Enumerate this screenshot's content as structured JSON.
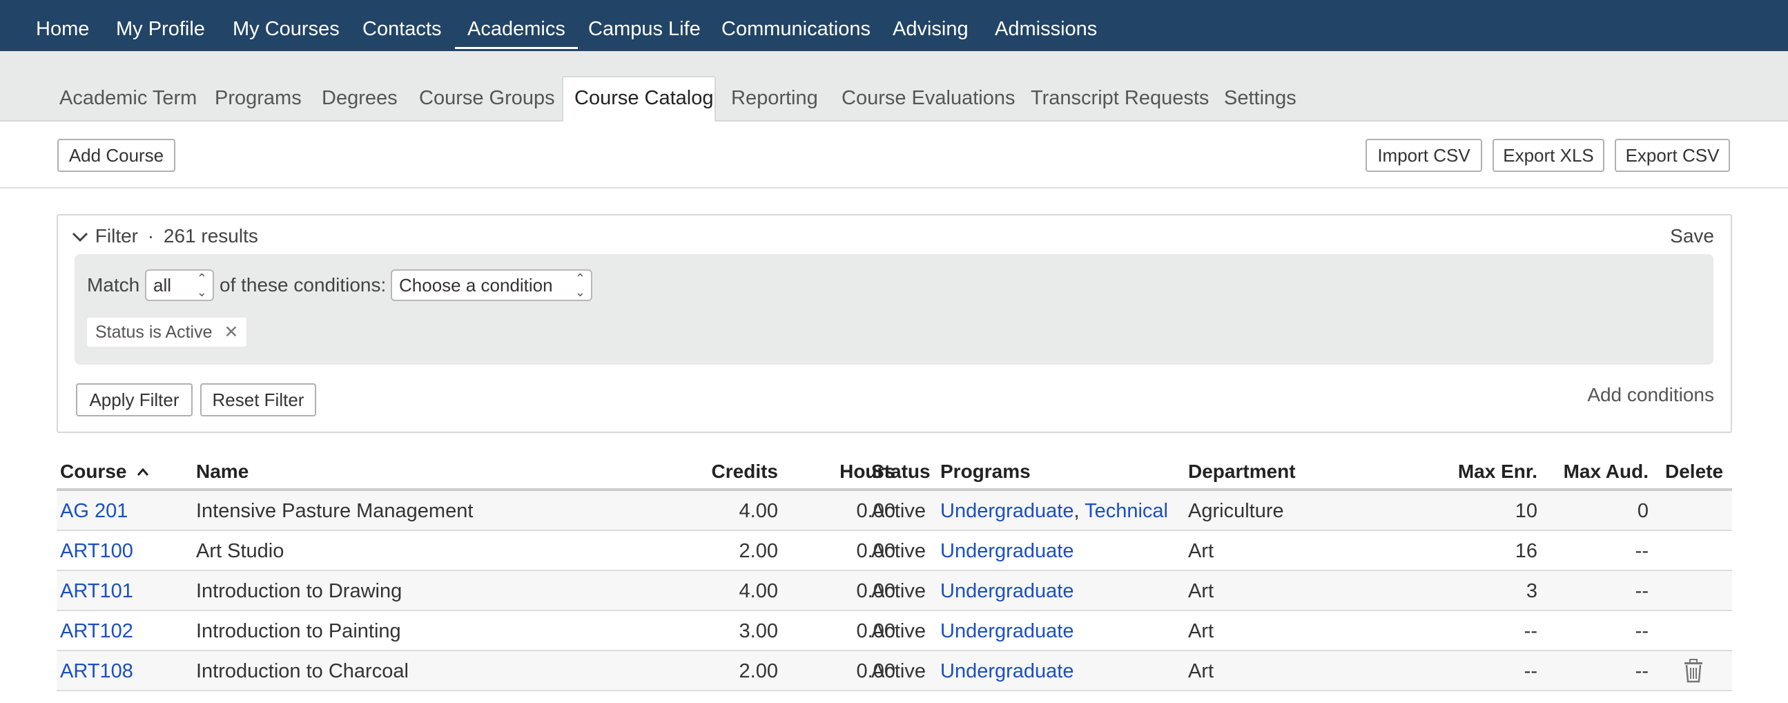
{
  "topnav": {
    "items": [
      "Home",
      "My Profile",
      "My Courses",
      "Contacts",
      "Academics",
      "Campus Life",
      "Communications",
      "Advising",
      "Admissions"
    ],
    "active": "Academics"
  },
  "subnav": {
    "items": [
      "Academic Term",
      "Programs",
      "Degrees",
      "Course Groups",
      "Course Catalog",
      "Reporting",
      "Course Evaluations",
      "Transcript Requests",
      "Settings"
    ],
    "active": "Course Catalog"
  },
  "toolbar": {
    "add_course": "Add Course",
    "import_csv": "Import CSV",
    "export_xls": "Export XLS",
    "export_csv": "Export CSV"
  },
  "filter": {
    "title": "Filter",
    "separator": "·",
    "results": "261 results",
    "save": "Save",
    "match_label": "Match",
    "match_value": "all",
    "conditions_label": "of these conditions:",
    "condition_select": "Choose a condition",
    "active_condition": "Status is Active",
    "apply": "Apply Filter",
    "reset": "Reset Filter",
    "add_conditions": "Add conditions"
  },
  "table": {
    "columns": {
      "course": "Course",
      "name": "Name",
      "credits": "Credits",
      "hours": "Hours",
      "status": "Status",
      "programs": "Programs",
      "department": "Department",
      "max_enr": "Max Enr.",
      "max_aud": "Max Aud.",
      "delete": "Delete"
    },
    "rows": [
      {
        "course": "AG 201",
        "name": "Intensive Pasture Management",
        "credits": "4.00",
        "hours": "0.00",
        "status": "Active",
        "program1": "Undergraduate",
        "program_sep": ", ",
        "program2": "Technical",
        "department": "Agriculture",
        "max_enr": "10",
        "max_aud": "0"
      },
      {
        "course": "ART100",
        "name": "Art Studio",
        "credits": "2.00",
        "hours": "0.00",
        "status": "Active",
        "program1": "Undergraduate",
        "department": "Art",
        "max_enr": "16",
        "max_aud": "--"
      },
      {
        "course": "ART101",
        "name": "Introduction to Drawing",
        "credits": "4.00",
        "hours": "0.00",
        "status": "Active",
        "program1": "Undergraduate",
        "department": "Art",
        "max_enr": "3",
        "max_aud": "--"
      },
      {
        "course": "ART102",
        "name": "Introduction to Painting",
        "credits": "3.00",
        "hours": "0.00",
        "status": "Active",
        "program1": "Undergraduate",
        "department": "Art",
        "max_enr": "--",
        "max_aud": "--"
      },
      {
        "course": "ART108",
        "name": "Introduction to Charcoal",
        "credits": "2.00",
        "hours": "0.00",
        "status": "Active",
        "program1": "Undergraduate",
        "department": "Art",
        "max_enr": "--",
        "max_aud": "--"
      }
    ]
  },
  "colors": {
    "topnav_bg": "#224466",
    "subnav_bg": "#e8e9e9",
    "link": "#1a4fc2"
  }
}
